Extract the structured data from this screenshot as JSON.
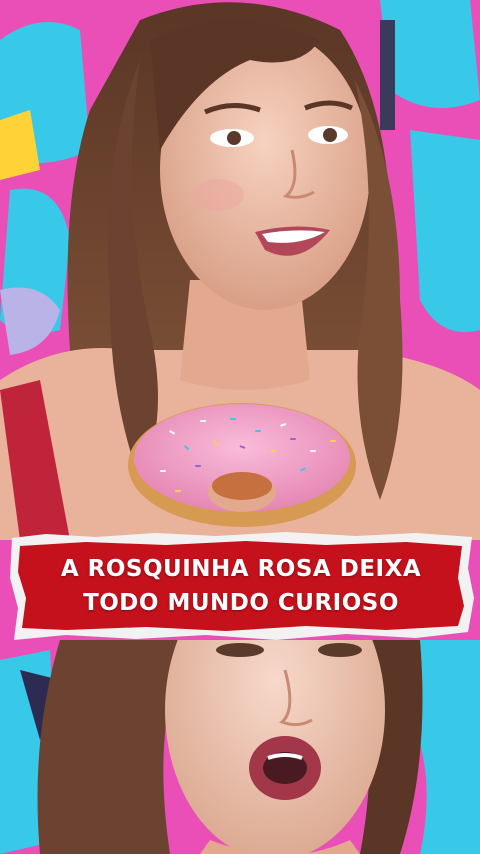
{
  "caption": {
    "line1": "A ROSQUINHA ROSA DEIXA",
    "line2": "TODO MUNDO CURIOSO"
  },
  "colors": {
    "background_pink": "#e94fb6",
    "graffiti_cyan": "#38c9e8",
    "caption_red": "#c4111b",
    "donut_icing": "#f3a1c8",
    "hair_brown": "#6b4330"
  },
  "icons": [
    "donut-icon"
  ]
}
